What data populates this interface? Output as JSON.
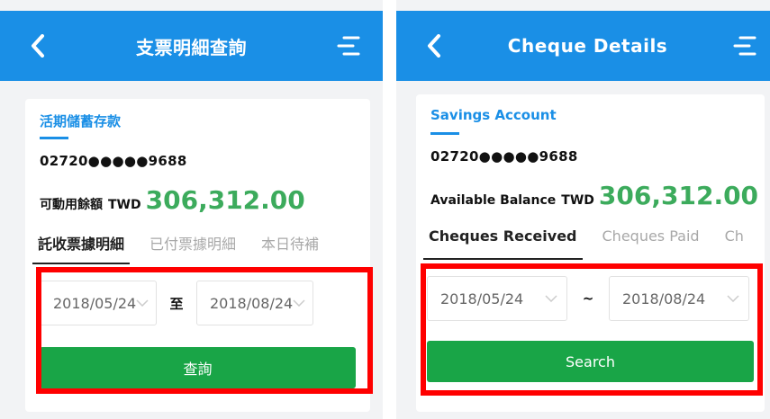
{
  "left": {
    "header": {
      "title": "支票明細查詢"
    },
    "account": {
      "name": "活期儲蓄存款",
      "number": "02720●●●●●9688",
      "balance_label": "可動用餘額",
      "currency": "TWD",
      "balance": "306,312.00"
    },
    "tabs": [
      "託收票據明細",
      "已付票據明細",
      "本日待補"
    ],
    "date_from": "2018/05/24",
    "separator": "至",
    "date_to": "2018/08/24",
    "search_label": "查詢"
  },
  "right": {
    "header": {
      "title": "Cheque Details"
    },
    "account": {
      "name": "Savings Account",
      "number": "02720●●●●●9688",
      "balance_label": "Available Balance",
      "currency": "TWD",
      "balance": "306,312.00"
    },
    "tabs": [
      "Cheques Received",
      "Cheques Paid",
      "Ch"
    ],
    "date_from": "2018/05/24",
    "separator": "~",
    "date_to": "2018/08/24",
    "search_label": "Search"
  },
  "colors": {
    "header_blue": "#1a8fe6",
    "balance_green": "#3cab5c",
    "button_green": "#19a547",
    "highlight_red": "#ff0000"
  },
  "icons": [
    "back-arrow-icon",
    "menu-icon",
    "chevron-down-icon"
  ]
}
